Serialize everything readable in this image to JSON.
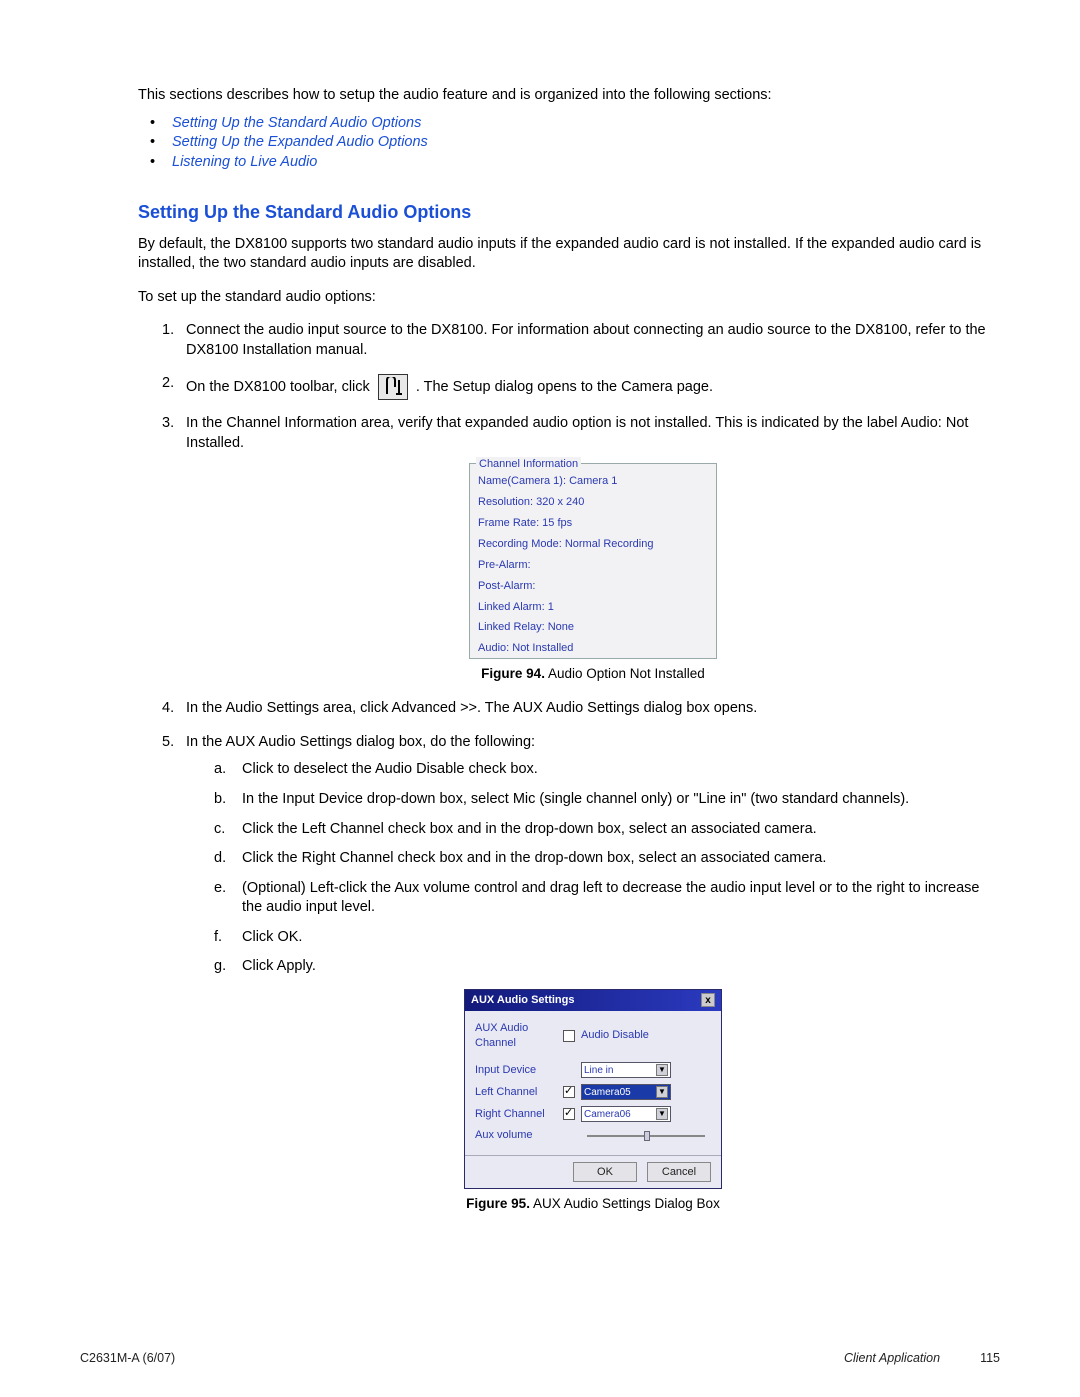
{
  "intro": "This sections describes how to setup the audio feature and is organized into the following sections:",
  "toc": {
    "item1": "Setting Up the Standard Audio Options",
    "item2": "Setting Up the Expanded Audio Options",
    "item3": "Listening to Live Audio"
  },
  "section_heading": "Setting Up the Standard Audio Options",
  "para1": "By default, the DX8100 supports two standard audio inputs if the expanded audio card is not installed. If the expanded audio card is installed, the two standard audio inputs are disabled.",
  "para2": "To set up the standard audio options:",
  "steps": {
    "n1": "1.",
    "s1": "Connect the audio input source to the DX8100. For information about connecting an audio source to the DX8100, refer to the DX8100 Installation manual.",
    "n2": "2.",
    "s2a": "On the DX8100 toolbar, click",
    "s2b": ". The Setup dialog opens to the Camera page.",
    "n3": "3.",
    "s3": "In the Channel Information area, verify that expanded audio option is not installed. This is indicated by the label Audio: Not Installed.",
    "n4": "4.",
    "s4": "In the Audio Settings area, click Advanced >>. The AUX Audio Settings dialog box opens.",
    "n5": "5.",
    "s5": "In the AUX Audio Settings dialog box, do the following:"
  },
  "substeps": {
    "la": "a.",
    "sa": "Click to deselect the Audio Disable check box.",
    "lb": "b.",
    "sb": "In the Input Device drop-down box, select Mic (single channel only) or \"Line in\" (two standard channels).",
    "lc": "c.",
    "sc": "Click the Left Channel check box and in the drop-down box, select an associated camera.",
    "ld": "d.",
    "sd": "Click the Right Channel check box and in the drop-down box, select an associated camera.",
    "le": "e.",
    "se": "(Optional) Left-click the Aux volume control and drag left to decrease the audio input level or to the right to increase the audio input level.",
    "lf": "f.",
    "sf": "Click OK.",
    "lg": "g.",
    "sg": "Click Apply."
  },
  "panel": {
    "title": "Channel Information",
    "r1": "Name(Camera 1):    Camera 1",
    "r2": "Resolution: 320 x 240",
    "r3": "Frame Rate: 15 fps",
    "r4": "Recording Mode: Normal Recording",
    "r5": "Pre-Alarm:",
    "r6": "Post-Alarm:",
    "r7": "Linked Alarm: 1",
    "r8": "Linked Relay: None",
    "r9": "Audio: Not Installed"
  },
  "fig94": {
    "num": "Figure 94.",
    "cap": "  Audio Option Not Installed"
  },
  "dialog": {
    "title": "AUX Audio Settings",
    "close": "x",
    "row1_lbl": "AUX Audio Channel",
    "row1_chk_lbl": "Audio Disable",
    "row2_lbl": "Input Device",
    "row2_val": "Line in",
    "row3_lbl": "Left Channel",
    "row3_val": "Camera05",
    "row4_lbl": "Right Channel",
    "row4_val": "Camera06",
    "row5_lbl": "Aux volume",
    "ok": "OK",
    "cancel": "Cancel"
  },
  "fig95": {
    "num": "Figure 95.",
    "cap": "  AUX Audio Settings Dialog Box"
  },
  "footer": {
    "left": "C2631M-A (6/07)",
    "caption": "Client Application",
    "page": "115"
  }
}
